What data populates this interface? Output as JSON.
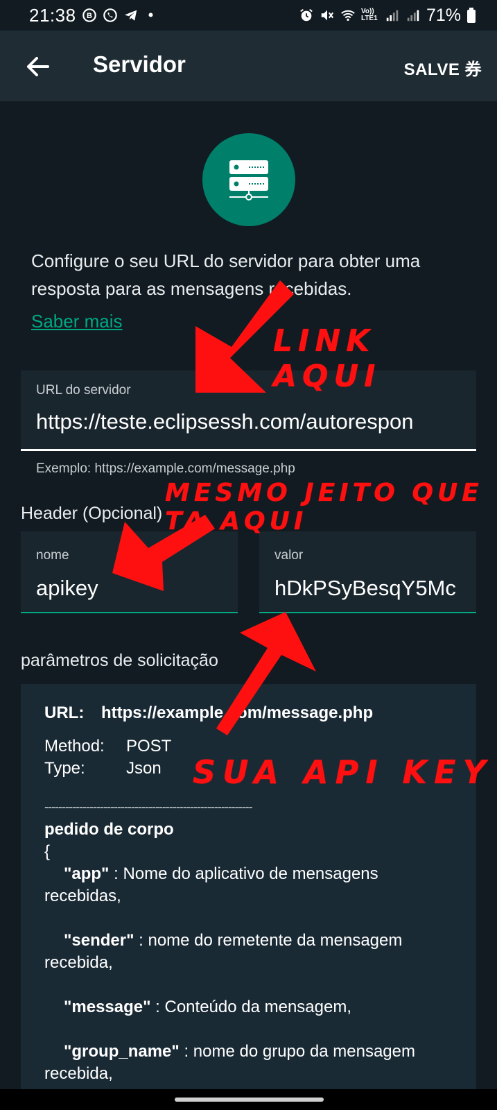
{
  "status_bar": {
    "time": "21:38",
    "battery": "71%",
    "dot": "•",
    "left_icons": [
      "whatsapp-business-icon",
      "whatsapp-icon",
      "telegram-icon"
    ],
    "right_icons": [
      "alarm-icon",
      "mute-icon",
      "wifi-icon",
      "volte-icon",
      "signal-icon",
      "signal-icon",
      "battery-icon"
    ],
    "network_badge": "Vo)) LTE1"
  },
  "app_bar": {
    "title": "Servidor",
    "save_label": "SALVE 券",
    "back_icon": "arrow-left-icon"
  },
  "intro": {
    "icon": "server-icon",
    "accent_color": "#00806a",
    "description": "Configure o seu URL do servidor para obter uma resposta para as mensagens recebidas.",
    "learn_more": "Saber mais"
  },
  "url_field": {
    "label": "URL do servidor",
    "value": "https://teste.eclipsessh.com/autorespon",
    "helper": "Exemplo: https://example.com/message.php"
  },
  "header_section": {
    "label": "Header (Opcional)",
    "name_field": {
      "label": "nome",
      "value": "apikey"
    },
    "value_field": {
      "label": "valor",
      "value": "hDkPSyBesqY5Mc"
    }
  },
  "params": {
    "label": "parâmetros de solicitação",
    "url_key": "URL:",
    "url_value": "https://example.com/message.php",
    "method_key": "Method:",
    "method_value": "POST",
    "type_key": "Type:",
    "type_value": "Json",
    "separator": "------------------------------------------------------------",
    "body_title": "pedido de corpo",
    "brace": "{",
    "items": [
      {
        "key": "\"app\"",
        "text": " : Nome do aplicativo de mensagens recebidas,"
      },
      {
        "key": "\"sender\"",
        "text": " : nome do remetente da mensagem recebida,"
      },
      {
        "key": "\"message\"",
        "text": " : Conteúdo da mensagem,"
      },
      {
        "key": "\"group_name\"",
        "text": " : nome do grupo da mensagem recebida,"
      }
    ]
  },
  "annotations": {
    "link": "LINK AQUI",
    "same": "MESMO JEITO QUE TA AQUI",
    "apikey": "SUA API KEY",
    "color": "#ff1010"
  }
}
